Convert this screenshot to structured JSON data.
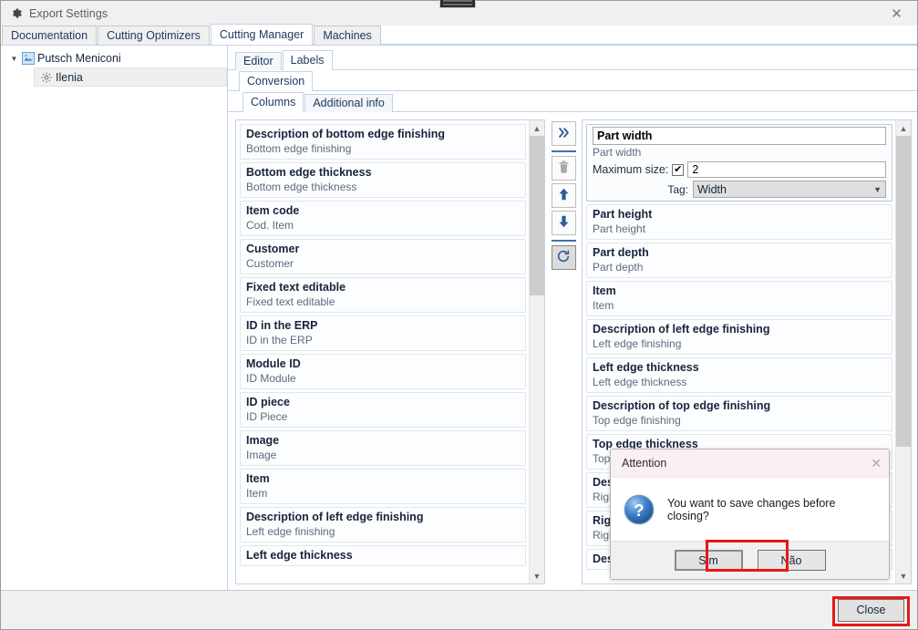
{
  "window": {
    "title": "Export Settings",
    "icon": "gear-icon",
    "close_label": "✕"
  },
  "tabs_level1": [
    {
      "label": "Documentation",
      "active": false
    },
    {
      "label": "Cutting Optimizers",
      "active": false
    },
    {
      "label": "Cutting Manager",
      "active": true
    },
    {
      "label": "Machines",
      "active": false
    }
  ],
  "tree": {
    "root": {
      "label": "Putsch Meniconi",
      "icon": "company-icon",
      "expanded": true
    },
    "child": {
      "label": "Ilenia",
      "icon": "gear-icon",
      "selected": true
    }
  },
  "tabs_level2": [
    {
      "label": "Editor",
      "active": false
    },
    {
      "label": "Labels",
      "active": true
    }
  ],
  "tabs_level3": [
    {
      "label": "Conversion",
      "active": true
    }
  ],
  "tabs_level4": [
    {
      "label": "Columns",
      "active": true
    },
    {
      "label": "Additional info",
      "active": false
    }
  ],
  "available_columns": {
    "items": [
      {
        "name": "Description of bottom edge finishing",
        "sub": "Bottom edge finishing"
      },
      {
        "name": "Bottom edge thickness",
        "sub": "Bottom edge thickness"
      },
      {
        "name": "Item code",
        "sub": "Cod. Item"
      },
      {
        "name": "Customer",
        "sub": "Customer"
      },
      {
        "name": "Fixed text editable",
        "sub": "Fixed text editable"
      },
      {
        "name": "ID in the ERP",
        "sub": "ID in the ERP"
      },
      {
        "name": "Module ID",
        "sub": "ID Module"
      },
      {
        "name": "ID piece",
        "sub": "ID Piece"
      },
      {
        "name": "Image",
        "sub": "Image"
      },
      {
        "name": "Item",
        "sub": "Item"
      },
      {
        "name": "Description of left edge finishing",
        "sub": "Left edge finishing"
      },
      {
        "name": "Left edge thickness",
        "sub": ""
      }
    ],
    "scroll_thumb_top_pct": 0,
    "scroll_thumb_height_pct": 37
  },
  "toolbar": {
    "buttons": [
      {
        "icon": "double-chevron-right-icon",
        "name": "add-column-button",
        "state": "enabled"
      },
      {
        "icon": "trash-icon",
        "name": "delete-column-button",
        "state": "disabled"
      },
      {
        "icon": "arrow-up-icon",
        "name": "move-up-button",
        "state": "enabled"
      },
      {
        "icon": "arrow-down-icon",
        "name": "move-down-button",
        "state": "enabled"
      },
      {
        "icon": "refresh-icon",
        "name": "reset-button",
        "state": "pressed"
      }
    ]
  },
  "selected_columns": {
    "selected_item": {
      "name_value": "Part width",
      "sub": "Part width",
      "max_size_label": "Maximum size:",
      "max_size_checked": true,
      "max_size_value": "2",
      "tag_label": "Tag:",
      "tag_value": "Width",
      "tag_arrow": "chevron-down-icon"
    },
    "items": [
      {
        "name": "Part height",
        "sub": "Part height"
      },
      {
        "name": "Part depth",
        "sub": "Part depth"
      },
      {
        "name": "Item",
        "sub": "Item"
      },
      {
        "name": "Description of left edge finishing",
        "sub": "Left edge finishing"
      },
      {
        "name": "Left edge thickness",
        "sub": "Left edge thickness"
      },
      {
        "name": "Description of top edge finishing",
        "sub": "Top edge finishing"
      },
      {
        "name": "Top edge thickness",
        "sub": "Top edge thickness"
      },
      {
        "name": "Description of right edge finishing",
        "sub": "Right edge finishing"
      },
      {
        "name": "Right edge thickness",
        "sub": "Right edge thickness"
      },
      {
        "name": "Description of bottom edge finishing",
        "sub": ""
      }
    ],
    "scroll_thumb_top_pct": 0,
    "scroll_thumb_height_pct": 72
  },
  "footer": {
    "close_label": "Close",
    "close_highlighted": true
  },
  "dialog": {
    "title": "Attention",
    "close_label": "✕",
    "icon": "question-icon",
    "message": "You want to save changes before closing?",
    "buttons": [
      {
        "label": "Sim",
        "primary": true,
        "highlighted": true
      },
      {
        "label": "Não",
        "primary": false,
        "highlighted": false
      }
    ]
  },
  "colors": {
    "highlight_red": "#e81717",
    "tab_border": "#c3d3e6",
    "item_text": "#18243c",
    "sub_text": "#5b6b80",
    "dialog_header": "#faeff5",
    "toolbar_accent": "#4472a8"
  }
}
